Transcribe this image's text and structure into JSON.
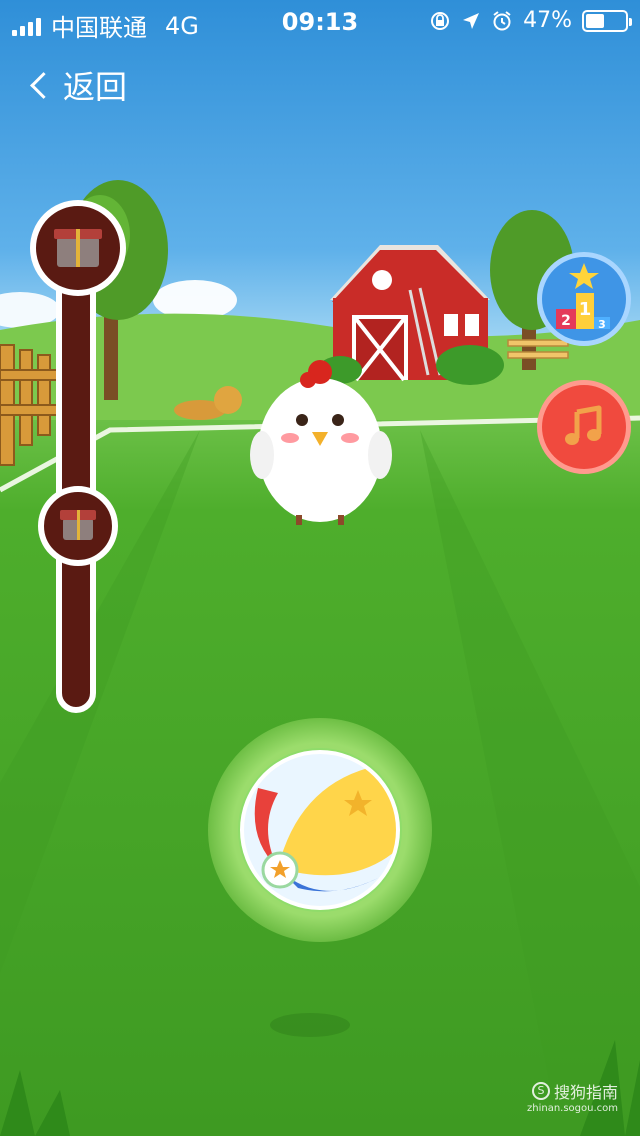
{
  "status_bar": {
    "carrier": "中国联通",
    "network": "4G",
    "time": "09:13",
    "battery": "47%",
    "battery_level": 0.47
  },
  "nav": {
    "back_label": "返回"
  },
  "rank_badge": {
    "first": "1",
    "second": "2",
    "third": "3"
  },
  "watermark": {
    "main": "搜狗指南",
    "sub": "zhinan.sogou.com",
    "logo": "S"
  },
  "icons": {
    "back": "chevron-left-icon",
    "gift": "gift-icon",
    "rank": "leaderboard-icon",
    "music": "music-note-icon",
    "ball": "beach-ball-icon",
    "pet": "chicken-icon"
  },
  "colors": {
    "rail": "#5a1a12",
    "rank_button": "#3f95e6",
    "music_button": "#f04a3e",
    "grass": "#4eae2c",
    "sky": "#5fb1ea"
  }
}
